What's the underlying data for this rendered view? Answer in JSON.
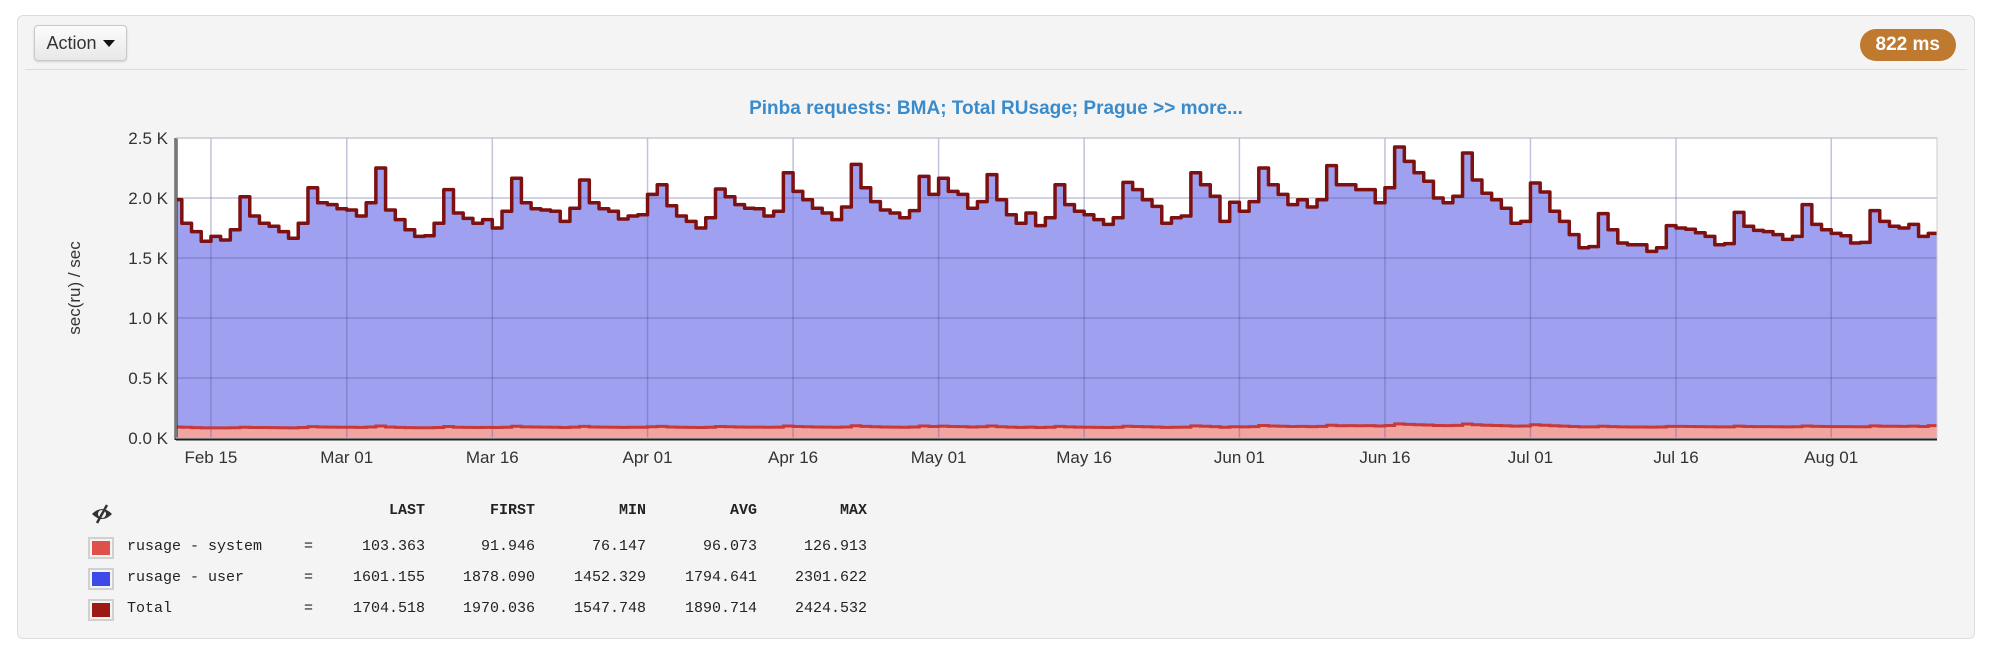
{
  "toolbar": {
    "action_label": "Action",
    "timing_badge": "822 ms",
    "badge_color": "#bf7a30"
  },
  "legend": {
    "toggle_icon": "eye-slash-icon",
    "columns": [
      "LAST",
      "FIRST",
      "MIN",
      "AVG",
      "MAX"
    ],
    "rows": [
      {
        "name": "rusage - system",
        "color": "#e0504a",
        "values": [
          "103.363",
          "91.946",
          "76.147",
          "96.073",
          "126.913"
        ]
      },
      {
        "name": "rusage - user",
        "color": "#3f48e8",
        "values": [
          "1601.155",
          "1878.090",
          "1452.329",
          "1794.641",
          "2301.622"
        ]
      },
      {
        "name": "Total",
        "color": "#9b1a14",
        "values": [
          "1704.518",
          "1970.036",
          "1547.748",
          "1890.714",
          "2424.532"
        ]
      }
    ]
  },
  "chart_data": {
    "type": "area",
    "title": "Pinba requests: BMA; Total RUsage; Prague >> more...",
    "xlabel": "",
    "ylabel": "sec(ru) / sec",
    "ylim": [
      0,
      2500
    ],
    "yticks": [
      "0.0 K",
      "0.5 K",
      "1.0 K",
      "1.5 K",
      "2.0 K",
      "2.5 K"
    ],
    "xlim": [
      "Feb 11",
      "Aug 11"
    ],
    "x_interval": "1 day",
    "xticks": [
      "Feb 15",
      "Mar 01",
      "Mar 16",
      "Apr 01",
      "Apr 16",
      "May 01",
      "May 16",
      "Jun 01",
      "Jun 16",
      "Jul 01",
      "Jul 16",
      "Aug 01"
    ],
    "grid": true,
    "stacked": true,
    "series": [
      {
        "name": "rusage - system",
        "fill": "#f2a4a0",
        "line": "#c8393a",
        "values": [
          92,
          90,
          86,
          84,
          84,
          84,
          85,
          90,
          88,
          87,
          86,
          85,
          84,
          88,
          95,
          92,
          91,
          90,
          90,
          89,
          92,
          100,
          92,
          89,
          86,
          85,
          85,
          88,
          96,
          90,
          89,
          88,
          89,
          87,
          90,
          98,
          93,
          92,
          91,
          90,
          88,
          91,
          97,
          92,
          91,
          90,
          89,
          90,
          90,
          94,
          97,
          92,
          90,
          89,
          88,
          90,
          96,
          94,
          92,
          91,
          91,
          90,
          91,
          100,
          96,
          94,
          92,
          91,
          90,
          92,
          102,
          97,
          94,
          92,
          91,
          90,
          92,
          100,
          96,
          99,
          96,
          95,
          92,
          94,
          100,
          94,
          91,
          89,
          91,
          88,
          90,
          97,
          93,
          91,
          90,
          89,
          88,
          90,
          98,
          96,
          94,
          92,
          89,
          90,
          91,
          101,
          98,
          95,
          90,
          94,
          93,
          95,
          104,
          100,
          98,
          96,
          97,
          95,
          97,
          106,
          102,
          103,
          102,
          103,
          100,
          104,
          118,
          114,
          110,
          108,
          104,
          103,
          105,
          117,
          110,
          106,
          104,
          102,
          99,
          100,
          110,
          106,
          102,
          99,
          96,
          93,
          93,
          98,
          95,
          93,
          92,
          92,
          91,
          92,
          97,
          97,
          96,
          95,
          94,
          93,
          93,
          99,
          96,
          95,
          95,
          94,
          93,
          94,
          100,
          97,
          96,
          95,
          95,
          94,
          94,
          101,
          98,
          98,
          97,
          99,
          96,
          103
        ]
      },
      {
        "name": "rusage - user",
        "fill": "#9fa1f0",
        "line": "#9fa1f0",
        "values": "stacked: Total minus rusage - system"
      },
      {
        "name": "Total",
        "line": "#7d1111",
        "values": [
          1986,
          1790,
          1720,
          1640,
          1680,
          1650,
          1735,
          2010,
          1850,
          1790,
          1765,
          1720,
          1665,
          1790,
          2085,
          1960,
          1945,
          1910,
          1900,
          1850,
          1960,
          2250,
          1900,
          1820,
          1735,
          1680,
          1685,
          1790,
          2070,
          1875,
          1830,
          1790,
          1820,
          1750,
          1890,
          2165,
          1960,
          1910,
          1900,
          1890,
          1805,
          1915,
          2150,
          1960,
          1910,
          1890,
          1825,
          1850,
          1860,
          2030,
          2110,
          1935,
          1850,
          1805,
          1750,
          1835,
          2075,
          2010,
          1945,
          1915,
          1910,
          1850,
          1890,
          2210,
          2055,
          1985,
          1915,
          1875,
          1820,
          1925,
          2280,
          2085,
          1970,
          1900,
          1875,
          1835,
          1895,
          2180,
          2030,
          2165,
          2055,
          2030,
          1915,
          1970,
          2195,
          1985,
          1860,
          1790,
          1875,
          1770,
          1835,
          2110,
          1945,
          1890,
          1860,
          1820,
          1780,
          1835,
          2130,
          2070,
          1985,
          1930,
          1790,
          1835,
          1850,
          2210,
          2110,
          2015,
          1805,
          1965,
          1890,
          1970,
          2250,
          2110,
          2030,
          1945,
          1985,
          1925,
          1985,
          2270,
          2110,
          2110,
          2070,
          2070,
          1960,
          2085,
          2425,
          2305,
          2210,
          2140,
          2000,
          1960,
          2015,
          2375,
          2150,
          2040,
          1985,
          1915,
          1790,
          1805,
          2125,
          2050,
          1890,
          1805,
          1695,
          1585,
          1595,
          1870,
          1735,
          1625,
          1610,
          1610,
          1555,
          1585,
          1770,
          1750,
          1740,
          1710,
          1680,
          1610,
          1620,
          1880,
          1765,
          1730,
          1720,
          1695,
          1655,
          1680,
          1945,
          1780,
          1735,
          1705,
          1685,
          1625,
          1630,
          1895,
          1805,
          1765,
          1750,
          1780,
          1680,
          1705
        ]
      }
    ]
  }
}
